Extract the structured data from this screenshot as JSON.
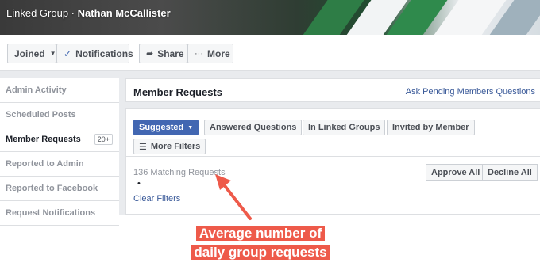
{
  "cover": {
    "group_name": "Linked Group",
    "separator": " · ",
    "admin_name": "Nathan McCallister"
  },
  "actions": {
    "joined": "Joined",
    "notifications": "Notifications",
    "share": "Share",
    "more": "More"
  },
  "sidebar": {
    "items": [
      {
        "label": "Admin Activity"
      },
      {
        "label": "Scheduled Posts"
      },
      {
        "label": "Member Requests",
        "count": "20+"
      },
      {
        "label": "Reported to Admin"
      },
      {
        "label": "Reported to Facebook"
      },
      {
        "label": "Request Notifications"
      }
    ]
  },
  "main": {
    "title": "Member Requests",
    "ask_link": "Ask Pending Members Questions",
    "filters": [
      "Suggested",
      "Answered Questions",
      "In Linked Groups",
      "Invited by Member",
      "More Filters"
    ],
    "matching": "136 Matching Requests",
    "bullet": "•",
    "clear": "Clear Filters",
    "approve_all": "Approve All",
    "decline_all": "Decline All"
  },
  "annotation": {
    "line1": "Average number of",
    "line2": "daily group requests",
    "color": "#ee5a4a"
  }
}
